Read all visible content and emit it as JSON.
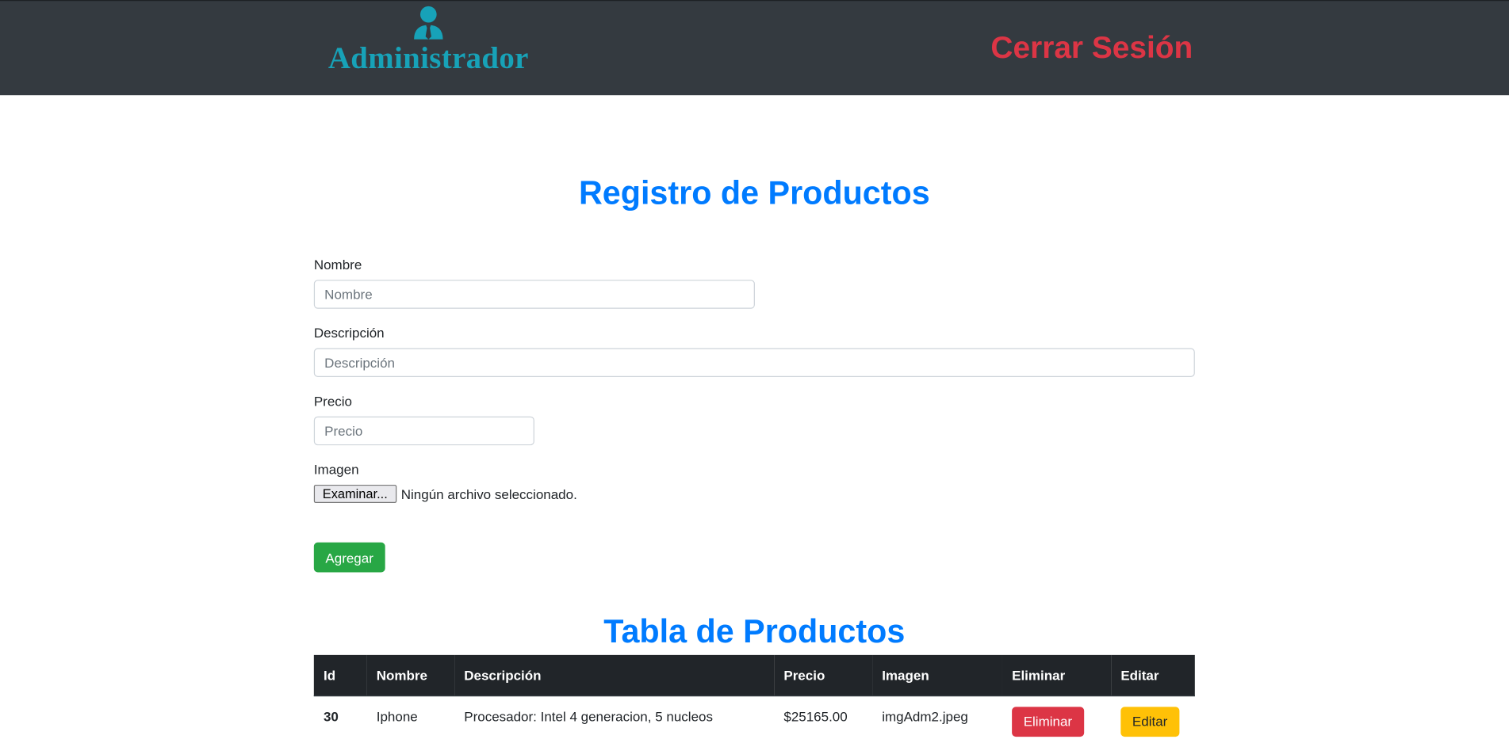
{
  "header": {
    "brand_label": "Administrador",
    "brand_icon": "user-tie-icon",
    "brand_color": "#17a2b8",
    "logout_label": "Cerrar Sesión",
    "logout_color": "#dc3545",
    "background": "#343a40"
  },
  "form": {
    "title": "Registro de Productos",
    "fields": {
      "nombre": {
        "label": "Nombre",
        "placeholder": "Nombre",
        "value": ""
      },
      "descripcion": {
        "label": "Descripción",
        "placeholder": "Descripción",
        "value": ""
      },
      "precio": {
        "label": "Precio",
        "placeholder": "Precio",
        "value": ""
      },
      "imagen": {
        "label": "Imagen",
        "button_label": "Examinar...",
        "status": "Ningún archivo seleccionado."
      }
    },
    "submit_label": "Agregar"
  },
  "table": {
    "title": "Tabla de Productos",
    "columns": [
      "Id",
      "Nombre",
      "Descripción",
      "Precio",
      "Imagen",
      "Eliminar",
      "Editar"
    ],
    "rows": [
      {
        "id": "30",
        "nombre": "Iphone",
        "descripcion": "Procesador: Intel 4 generacion, 5 nucleos",
        "precio": "$25165.00",
        "imagen": "imgAdm2.jpeg",
        "delete_label": "Eliminar",
        "edit_label": "Editar"
      }
    ]
  },
  "colors": {
    "primary": "#007bff",
    "success": "#28a745",
    "danger": "#dc3545",
    "warning": "#ffc107",
    "dark": "#212529"
  }
}
